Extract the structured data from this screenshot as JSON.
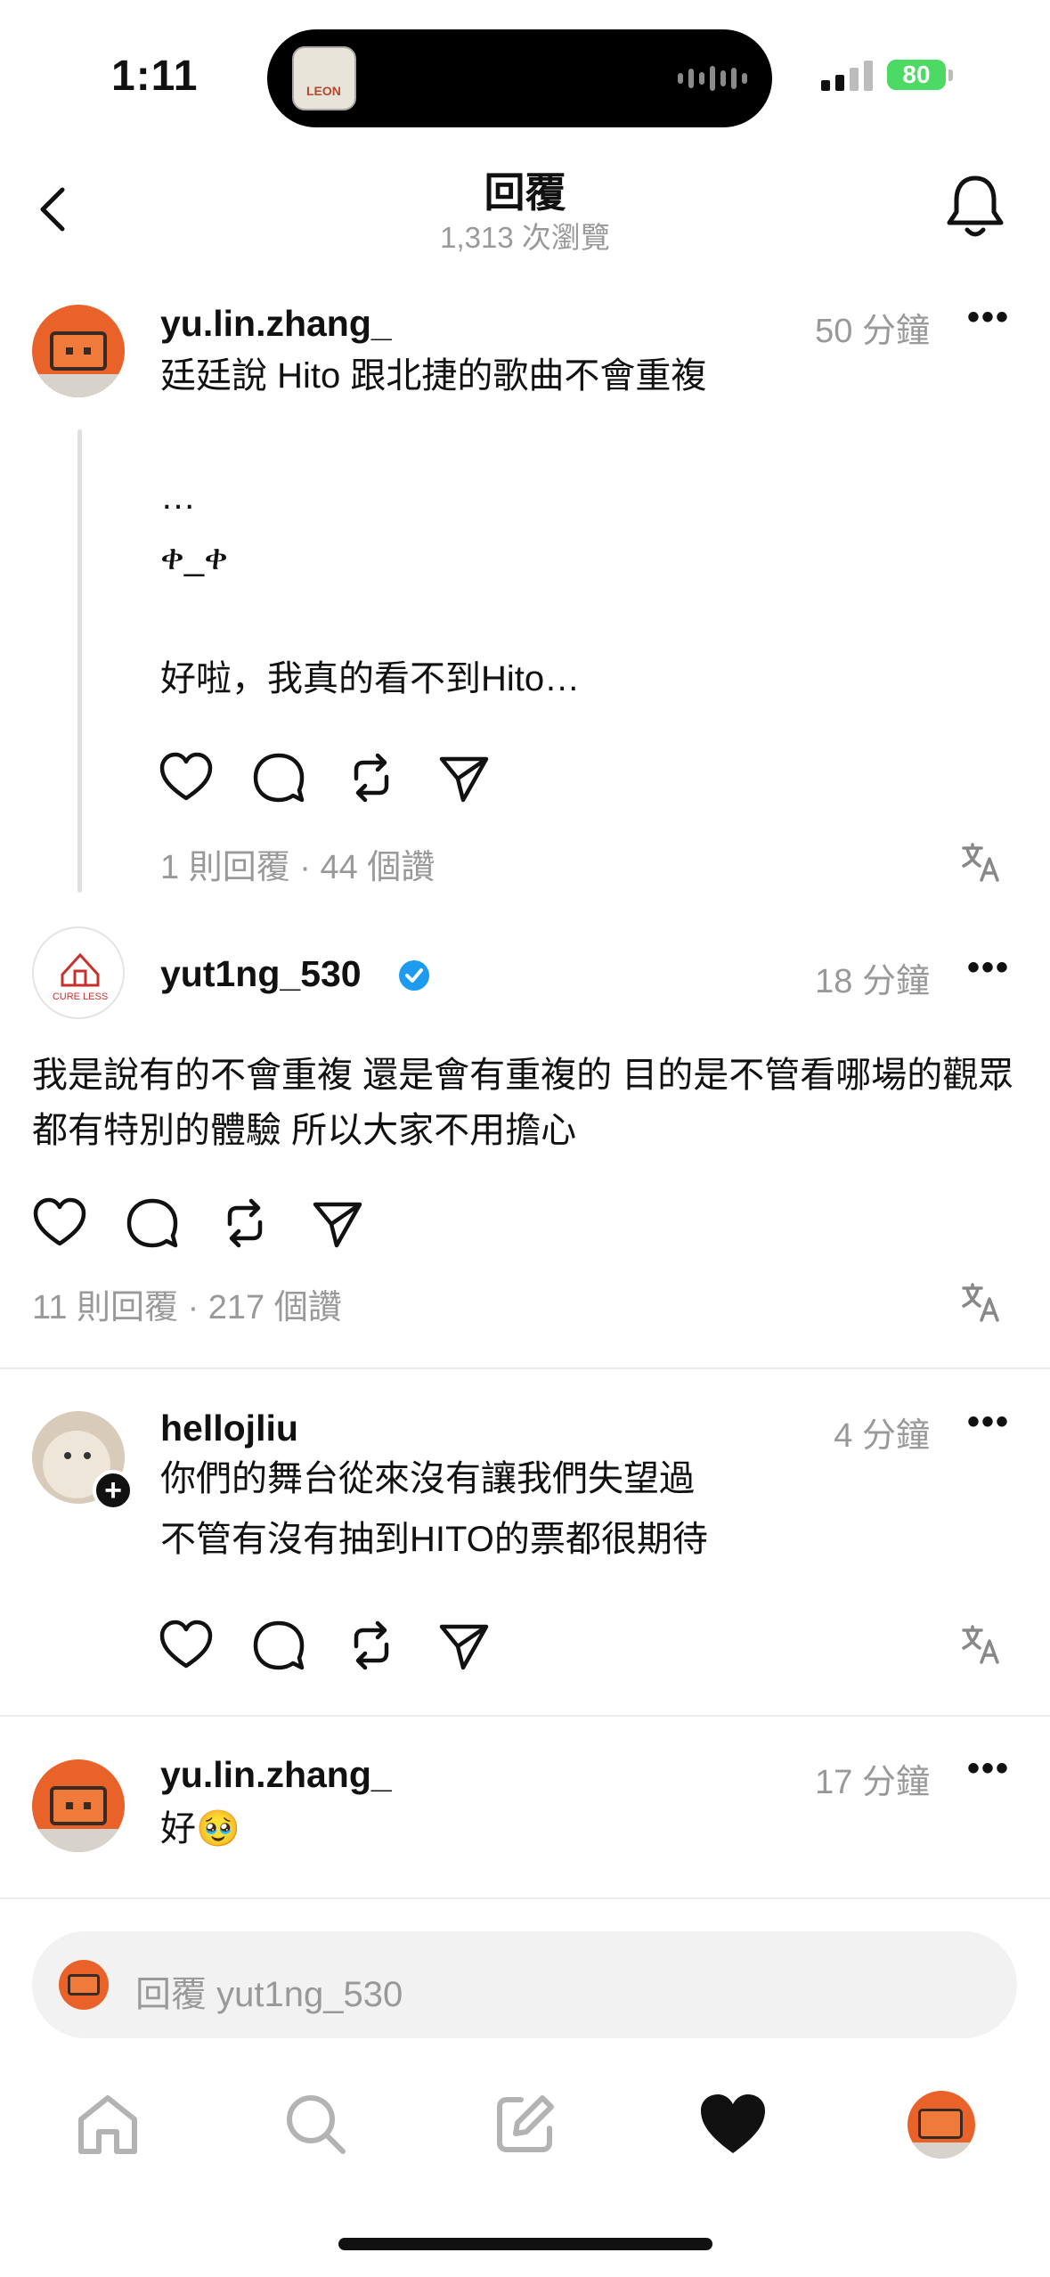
{
  "status_bar": {
    "time": "1:11",
    "battery": "80"
  },
  "header": {
    "title": "回覆",
    "views": "1,313 次瀏覽"
  },
  "posts": [
    {
      "username": "yu.lin.zhang_",
      "time": "50 分鐘",
      "text": "廷廷說 Hito 跟北捷的歌曲不會重複\n\n…\nቀ_ቀ\n\n好啦，我真的看不到Hito…",
      "meta": "1 則回覆 · 44 個讚"
    },
    {
      "username": "yut1ng_530",
      "time": "18 分鐘",
      "text": "我是說有的不會重複 還是會有重複的 目的是不管看哪場的觀眾都有特別的體驗 所以大家不用擔心",
      "meta": "11 則回覆 · 217 個讚"
    },
    {
      "username": "hellojliu",
      "time": "4 分鐘",
      "text": "你們的舞台從來沒有讓我們失望過\n不管有沒有抽到HITO的票都很期待"
    },
    {
      "username": "yu.lin.zhang_",
      "time": "17 分鐘",
      "text": "好🥹"
    }
  ],
  "reply_bar": {
    "placeholder": "回覆 yut1ng_530"
  },
  "avatar_label": "CURE LESS",
  "colors": {
    "accent_verified": "#1d9bf0",
    "battery": "#4cd964",
    "avatar_orange": "#e8622a"
  }
}
